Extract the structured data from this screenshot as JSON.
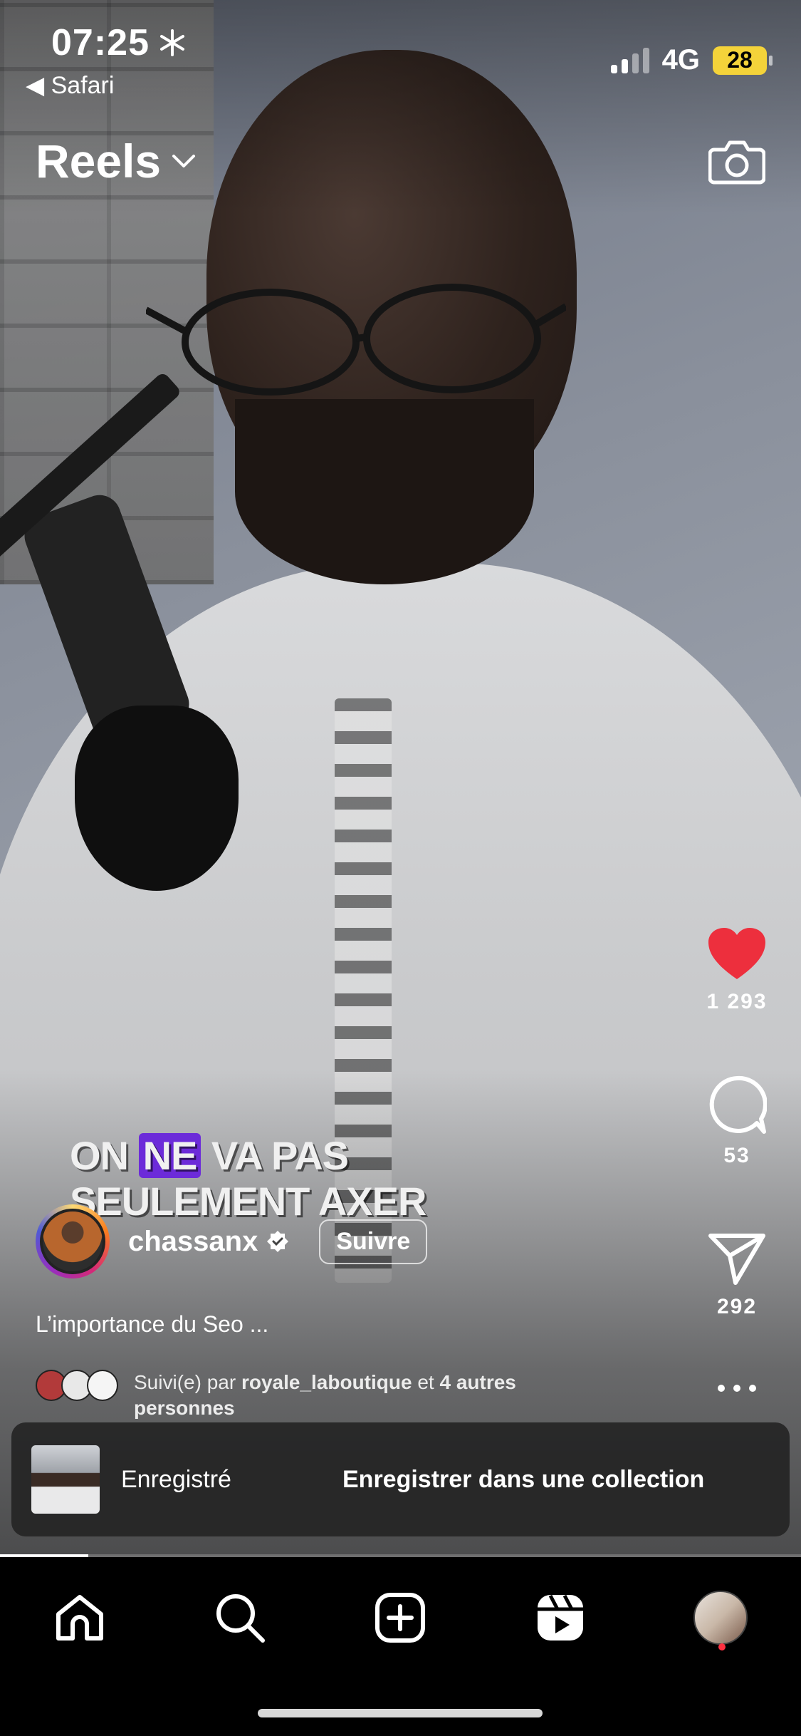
{
  "status_bar": {
    "time": "07:25",
    "back_label": "◀ Safari",
    "network": "4G",
    "battery": "28"
  },
  "header": {
    "title": "Reels"
  },
  "video": {
    "caption_line1_a": "ON ",
    "caption_line1_highlight": "NE",
    "caption_line1_b": " VA PAS",
    "caption_line2": "SEULEMENT AXER"
  },
  "actions": {
    "likes": "1 293",
    "comments": "53",
    "shares": "292"
  },
  "author": {
    "username": "chassanx",
    "follow_label": "Suivre",
    "description": "L’importance du Seo ..."
  },
  "followed_by": {
    "prefix": "Suivi(e) par ",
    "user": "royale_laboutique",
    "middle": " et ",
    "others": "4 autres",
    "suffix": "personnes"
  },
  "toast": {
    "status": "Enregistré",
    "action": "Enregistrer dans une collection"
  },
  "playback": {
    "progress": 0.11
  },
  "colors": {
    "like": "#ed2f3d",
    "highlight": "#6c2bd9",
    "battery": "#f4d33a",
    "notification_dot": "#ff3040"
  }
}
